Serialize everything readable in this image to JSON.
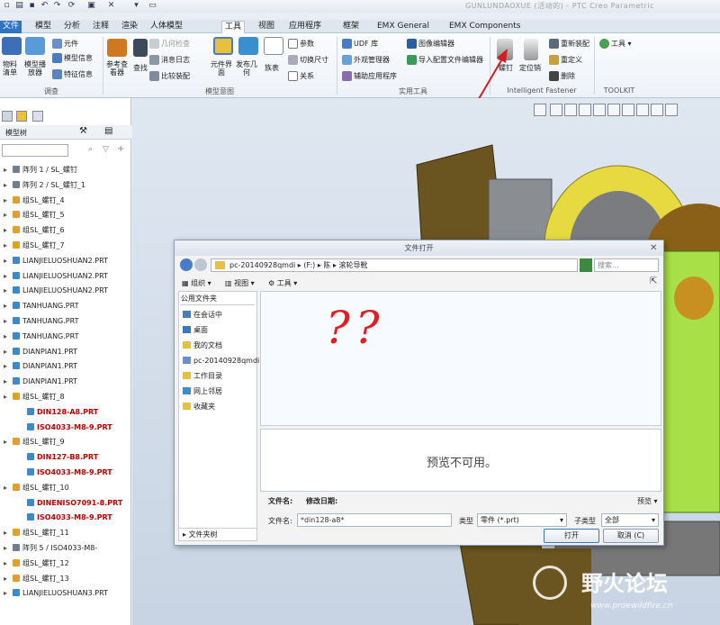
{
  "app": {
    "title": "GUNLUNDAOXUE (活动的) - PTC Creo Parametric"
  },
  "menu": {
    "tabs": [
      "文件",
      "模型",
      "分析",
      "注释",
      "渲染",
      "人体模型",
      "工具",
      "视图",
      "应用程序",
      "框架",
      "EMX General",
      "EMX Components"
    ],
    "active": "工具"
  },
  "ribbon": {
    "investigate": {
      "label": "调查",
      "big_buttons": [
        "物料清单",
        "模型播放器"
      ],
      "small": [
        "元件",
        "模型信息",
        "特征信息"
      ]
    },
    "model_intent": {
      "label": "模型意图",
      "big_buttons": [
        "参考查看器",
        "查找",
        "元件界面",
        "发布几何",
        "族表"
      ],
      "small": [
        "几何检查",
        "消息日志",
        "比较装配",
        "参数",
        "切换尺寸",
        "关系"
      ]
    },
    "utilities": {
      "label": "实用工具",
      "small": [
        "UDF 库",
        "外观管理器",
        "辅助应用程序",
        "图像编辑器",
        "导入配置文件编辑器"
      ]
    },
    "fastener": {
      "label": "Intelligent Fastener",
      "items": [
        "螺钉",
        "定位销",
        "重新装配",
        "重定义",
        "删除"
      ]
    },
    "toolkit": {
      "label": "TOOLKIT",
      "items": [
        "工具"
      ]
    }
  },
  "tree": {
    "title": "模型树",
    "items": [
      {
        "label": "阵列 1 / SL_螺钉",
        "red": false,
        "icon": "pattern-icon"
      },
      {
        "label": "阵列 2 / SL_螺钉_1",
        "red": false,
        "icon": "pattern-icon"
      },
      {
        "label": "组SL_螺钉_4",
        "red": false,
        "icon": "group-icon"
      },
      {
        "label": "组SL_螺钉_5",
        "red": false,
        "icon": "group-icon"
      },
      {
        "label": "组SL_螺钉_6",
        "red": false,
        "icon": "group-icon"
      },
      {
        "label": "组SL_螺钉_7",
        "red": false,
        "icon": "group-icon"
      },
      {
        "label": "LIANJIELUOSHUAN2.PRT",
        "red": false,
        "icon": "part-icon"
      },
      {
        "label": "LIANJIELUOSHUAN2.PRT",
        "red": false,
        "icon": "part-icon"
      },
      {
        "label": "LIANJIELUOSHUAN2.PRT",
        "red": false,
        "icon": "part-icon"
      },
      {
        "label": "TANHUANG.PRT",
        "red": false,
        "icon": "part-icon"
      },
      {
        "label": "TANHUANG.PRT",
        "red": false,
        "icon": "part-icon"
      },
      {
        "label": "TANHUANG.PRT",
        "red": false,
        "icon": "part-icon"
      },
      {
        "label": "DIANPIAN1.PRT",
        "red": false,
        "icon": "part-icon"
      },
      {
        "label": "DIANPIAN1.PRT",
        "red": false,
        "icon": "part-icon"
      },
      {
        "label": "DIANPIAN1.PRT",
        "red": false,
        "icon": "part-icon"
      },
      {
        "label": "组SL_螺钉_8",
        "red": false,
        "icon": "group-icon"
      },
      {
        "label": "DIN128-A8.PRT",
        "red": true,
        "icon": "part-icon"
      },
      {
        "label": "ISO4033-M8-9.PRT",
        "red": true,
        "icon": "part-icon"
      },
      {
        "label": "组SL_螺钉_9",
        "red": false,
        "icon": "group-icon"
      },
      {
        "label": "DIN127-B8.PRT",
        "red": true,
        "icon": "part-icon"
      },
      {
        "label": "ISO4033-M8-9.PRT",
        "red": true,
        "icon": "part-icon"
      },
      {
        "label": "组SL_螺钉_10",
        "red": false,
        "icon": "group-icon"
      },
      {
        "label": "DINENISO7091-8.PRT",
        "red": true,
        "icon": "part-icon"
      },
      {
        "label": "ISO4033-M8-9.PRT",
        "red": true,
        "icon": "part-icon"
      },
      {
        "label": "组SL_螺钉_11",
        "red": false,
        "icon": "group-icon"
      },
      {
        "label": "阵列 5 / ISO4033-M8-",
        "red": false,
        "icon": "pattern-icon"
      },
      {
        "label": "组SL_螺钉_12",
        "red": false,
        "icon": "group-icon"
      },
      {
        "label": "组SL_螺钉_13",
        "red": false,
        "icon": "group-icon"
      },
      {
        "label": "LIANJIELUOSHUAN3.PRT",
        "red": false,
        "icon": "part-icon"
      }
    ]
  },
  "dialog": {
    "title": "文件打开",
    "path": [
      "pc-20140928qmdi",
      "(F:)",
      "陈",
      "滚轮导靴"
    ],
    "search_placeholder": "搜索...",
    "toolbar": {
      "organize": "组织",
      "views": "视图",
      "tools": "工具"
    },
    "sidebar_title": "公用文件夹",
    "folders": [
      "在会话中",
      "桌面",
      "我的文档",
      "pc-20140928qmdi",
      "工作目录",
      "网上邻居",
      "收藏夹"
    ],
    "folder_tree": "文件夹树",
    "content_annotation": "??",
    "preview_text": "预览不可用。",
    "columns": [
      "文件名:",
      "修改日期:"
    ],
    "preview_label": "预览",
    "filename_label": "文件名:",
    "filename_value": "*din128-a8*",
    "type_label": "类型",
    "type_value": "零件 (*.prt)",
    "subtype_label": "子类型",
    "subtype_value": "全部",
    "open": "打开",
    "cancel": "取消 (C)"
  },
  "watermark": {
    "text": "野火论坛",
    "url": "www.proewildfire.cn"
  },
  "colors": {
    "accent": "#2f74c0",
    "red_items": "#c00000",
    "annotation_red": "#e02020"
  }
}
